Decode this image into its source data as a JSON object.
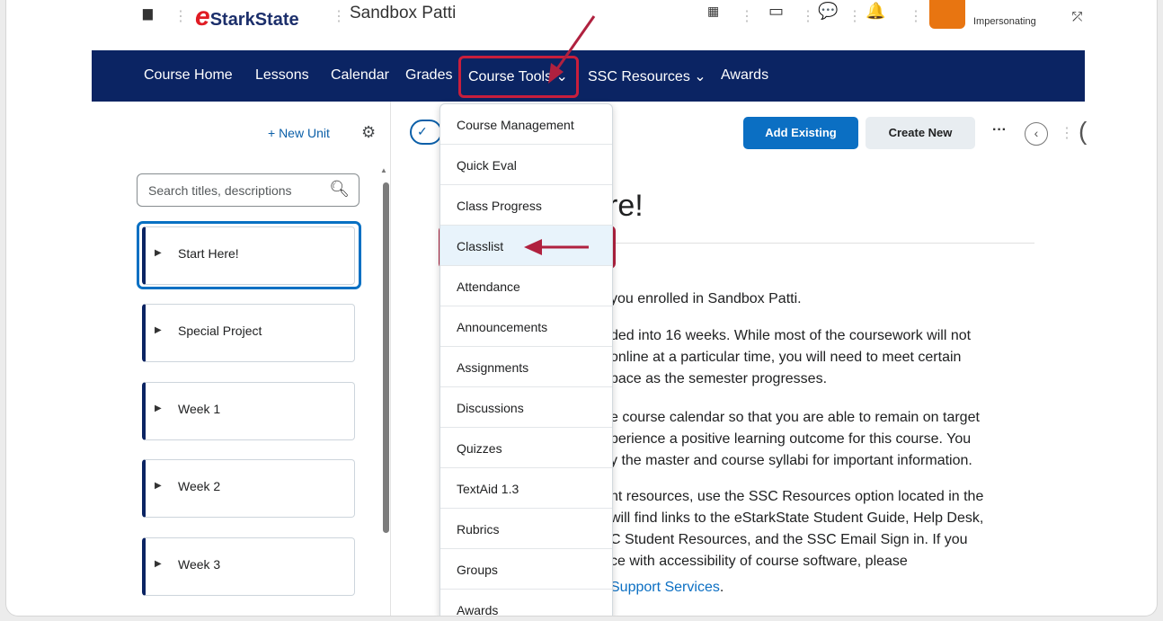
{
  "topbar": {
    "home_icon": "home-icon",
    "logo_prefix": "e",
    "logo_text": "StarkState",
    "course_name": "Sandbox Patti",
    "impersonating_label": "Impersonating"
  },
  "nav": {
    "items": [
      "Course Home",
      "Lessons",
      "Calendar",
      "Grades",
      "Course Tools ⌄",
      "SSC Resources ⌄",
      "Awards"
    ]
  },
  "sidebar": {
    "new_unit": "+ New Unit",
    "search_placeholder": "Search titles, descriptions",
    "units": [
      "Start Here!",
      "Special Project",
      "Week 1",
      "Week 2",
      "Week 3"
    ]
  },
  "toolbar": {
    "add_existing": "Add Existing",
    "create_new": "Create New",
    "more": "···"
  },
  "content": {
    "title_fragment": "re!",
    "paragraphs": [
      "you enrolled in Sandbox Patti.",
      "ded into 16 weeks. While most of the coursework will not",
      "online at a particular time, you will need to meet certain",
      "pace as the semester progresses.",
      "e course calendar so that you are able to remain on target",
      "perience a positive learning outcome for this course. You",
      "y the master and course syllabi for important information.",
      "nt resources, use the SSC Resources option located in the",
      "will find links to the eStarkState Student Guide, Help Desk,",
      "C Student Resources, and the SSC Email Sign in. If you",
      "ce with accessibility of course software, please"
    ],
    "link_text": "Support Services",
    "link_suffix": "."
  },
  "dropdown": {
    "items": [
      "Course Management",
      "Quick Eval",
      "Class Progress",
      "Classlist",
      "Attendance",
      "Announcements",
      "Assignments",
      "Discussions",
      "Quizzes",
      "TextAid 1.3",
      "Rubrics",
      "Groups",
      "Awards"
    ],
    "highlighted": "Classlist"
  },
  "colors": {
    "navbar": "#0b2463",
    "annotation": "#b0213f",
    "primary_button": "#0b6fc3"
  }
}
